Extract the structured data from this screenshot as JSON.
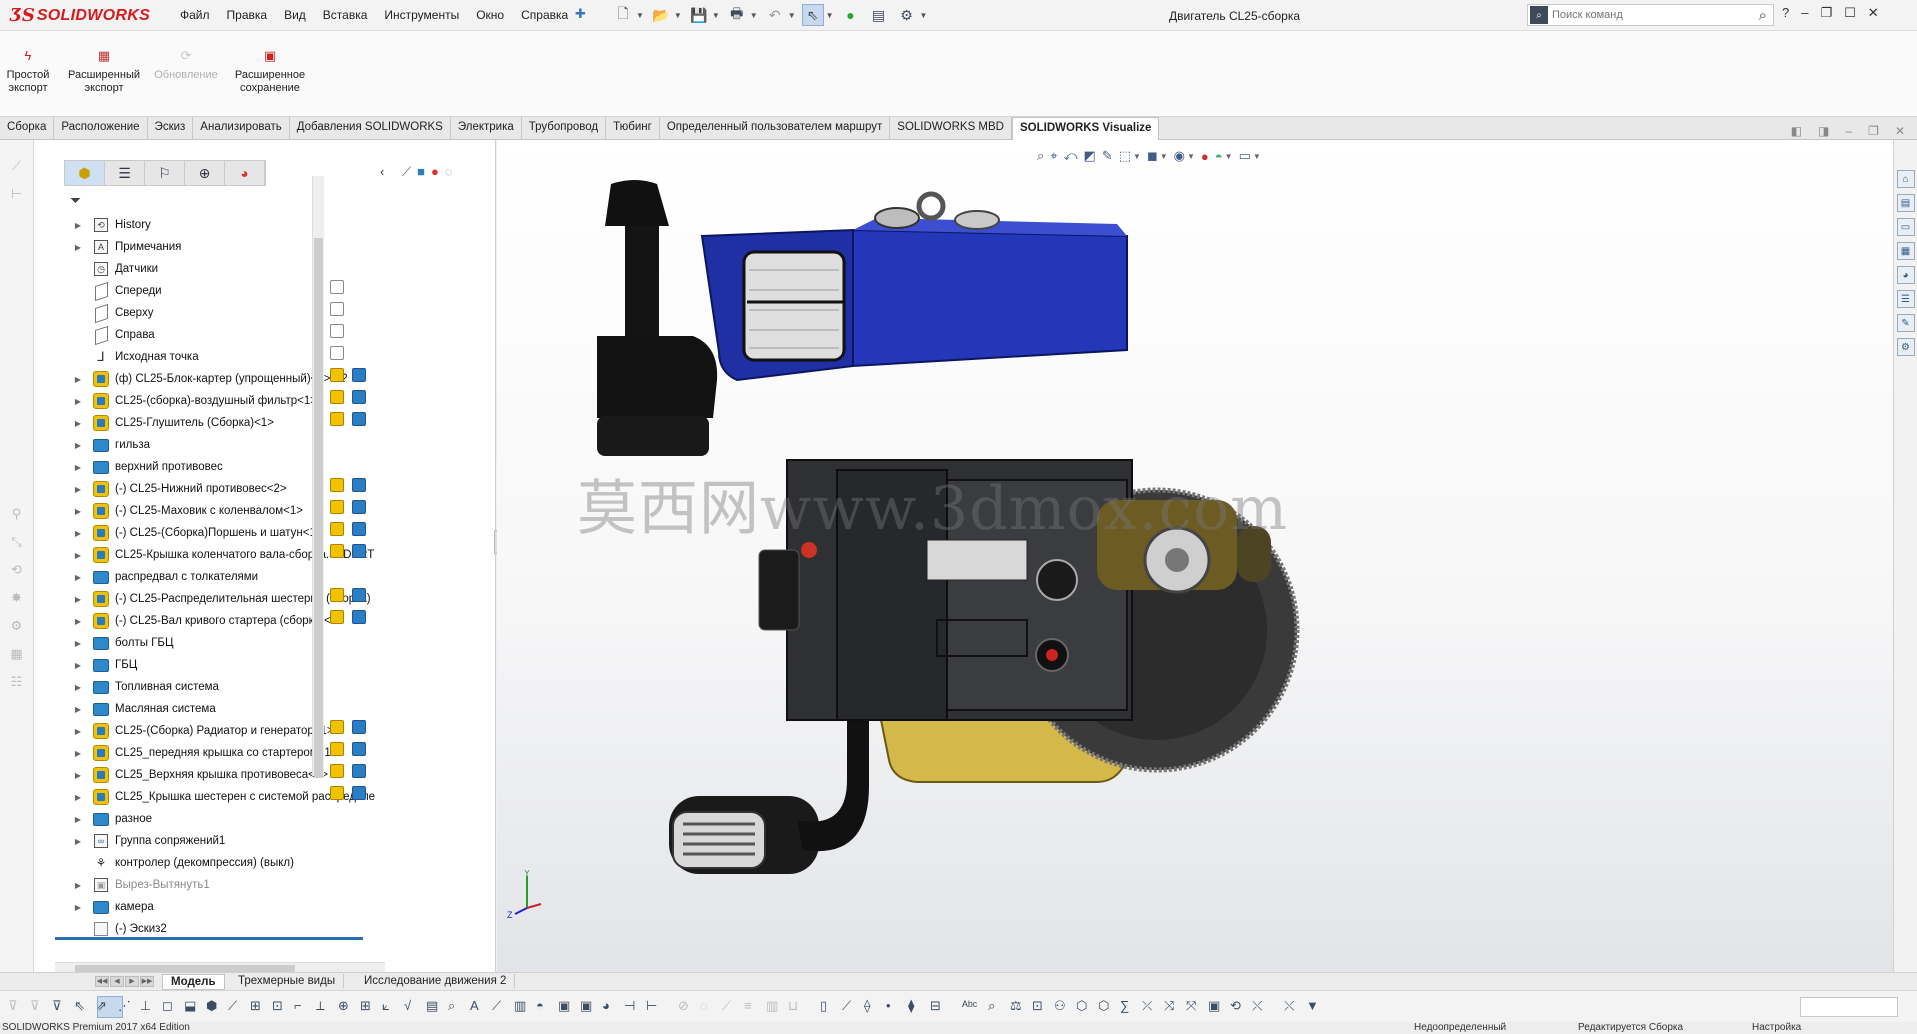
{
  "app": {
    "brand": "SOLIDWORKS",
    "document_title": "Двигатель CL25-сборка"
  },
  "menu": [
    "Файл",
    "Правка",
    "Вид",
    "Вставка",
    "Инструменты",
    "Окно",
    "Справка"
  ],
  "search": {
    "placeholder": "Поиск команд"
  },
  "command_manager": {
    "simple_export": "Простой экспорт",
    "advanced_export": "Расширенный экспорт",
    "update": "Обновление",
    "advanced_save": "Расширенное сохранение"
  },
  "tabs": [
    "Сборка",
    "Расположение",
    "Эскиз",
    "Анализировать",
    "Добавления SOLIDWORKS",
    "Электрика",
    "Трубопровод",
    "Тюбинг",
    "Определенный пользователем маршрут",
    "SOLIDWORKS MBD",
    "SOLIDWORKS Visualize"
  ],
  "active_tab": "SOLIDWORKS Visualize",
  "tree": [
    {
      "label": "History",
      "icon": "history-folder-icon",
      "expandable": true
    },
    {
      "label": "Примечания",
      "icon": "annotations-icon",
      "expandable": true
    },
    {
      "label": "Датчики",
      "icon": "sensors-icon",
      "expandable": false
    },
    {
      "label": "Спереди",
      "icon": "plane-icon",
      "expandable": false
    },
    {
      "label": "Сверху",
      "icon": "plane-icon",
      "expandable": false
    },
    {
      "label": "Справа",
      "icon": "plane-icon",
      "expandable": false
    },
    {
      "label": "Исходная точка",
      "icon": "origin-icon",
      "expandable": false
    },
    {
      "label": "(ф) CL25-Блок-картер (упрощенный)<1>->?",
      "icon": "assembly-icon",
      "expandable": true
    },
    {
      "label": "CL25-(сборка)-воздушный фильтр<1>",
      "icon": "assembly-icon",
      "expandable": true
    },
    {
      "label": "CL25-Глушитель (Сборка)<1>",
      "icon": "assembly-icon",
      "expandable": true
    },
    {
      "label": "гильза",
      "icon": "folder-icon",
      "expandable": true
    },
    {
      "label": "верхний противовес",
      "icon": "folder-icon",
      "expandable": true
    },
    {
      "label": "(-) CL25-Нижний противовес<2>",
      "icon": "assembly-icon",
      "expandable": true
    },
    {
      "label": "(-) CL25-Маховик с коленвалом<1>",
      "icon": "assembly-icon",
      "expandable": true
    },
    {
      "label": "(-) CL25-(Сборка)Поршень и шатун<1>",
      "icon": "assembly-icon",
      "expandable": true
    },
    {
      "label": "CL25-Крышка коленчатого вала-сборка.SLDPRT",
      "icon": "assembly-icon",
      "expandable": true
    },
    {
      "label": "распредвал с толкателями",
      "icon": "folder-icon",
      "expandable": true
    },
    {
      "label": "(-) CL25-Распределительная шестерня (сборка)",
      "icon": "assembly-icon",
      "expandable": true
    },
    {
      "label": "(-) CL25-Вал кривого стартера (сборка)<1>",
      "icon": "assembly-icon",
      "expandable": true
    },
    {
      "label": "болты ГБЦ",
      "icon": "folder-icon",
      "expandable": true
    },
    {
      "label": "ГБЦ",
      "icon": "folder-icon",
      "expandable": true
    },
    {
      "label": "Топливная система",
      "icon": "folder-icon",
      "expandable": true
    },
    {
      "label": "Масляная система",
      "icon": "folder-icon",
      "expandable": true
    },
    {
      "label": "CL25-(Сборка) Радиатор и генератор<1>",
      "icon": "assembly-icon",
      "expandable": true
    },
    {
      "label": "CL25_передняя крышка со стартером<1>",
      "icon": "assembly-icon",
      "expandable": true
    },
    {
      "label": "CL25_Верхняя крышка противовеса<1>",
      "icon": "assembly-icon",
      "expandable": true
    },
    {
      "label": "CL25_Крышка шестерен с системой распределе",
      "icon": "assembly-icon",
      "expandable": true
    },
    {
      "label": "разное",
      "icon": "folder-icon",
      "expandable": true
    },
    {
      "label": "Группа сопряжений1",
      "icon": "mates-icon",
      "expandable": true
    },
    {
      "label": "контролер (декомпрессия) (выкл)",
      "icon": "controller-icon",
      "expandable": false
    },
    {
      "label": "Вырез-Вытянуть1",
      "icon": "cut-extrude-icon",
      "expandable": true,
      "dim": true
    },
    {
      "label": "камера",
      "icon": "folder-icon",
      "expandable": true
    },
    {
      "label": "(-) Эскиз2",
      "icon": "sketch-icon",
      "expandable": false
    }
  ],
  "watermark": "莫西网www.3dmox.com",
  "bottom_tabs": [
    "Модель",
    "Трехмерные виды",
    "Исследование движения 2"
  ],
  "status_bar": {
    "edition": "SOLIDWORKS Premium 2017 x64 Edition",
    "definition": "Недоопределенный",
    "mode": "Редактируется Сборка",
    "settings": "Настройка"
  },
  "colors": {
    "brand_red": "#d7191c",
    "accent_blue": "#2a6cb5",
    "folder_blue": "#2f88c9",
    "assembly_yellow": "#f2c200",
    "engine_blue": "#1f2fa4"
  }
}
